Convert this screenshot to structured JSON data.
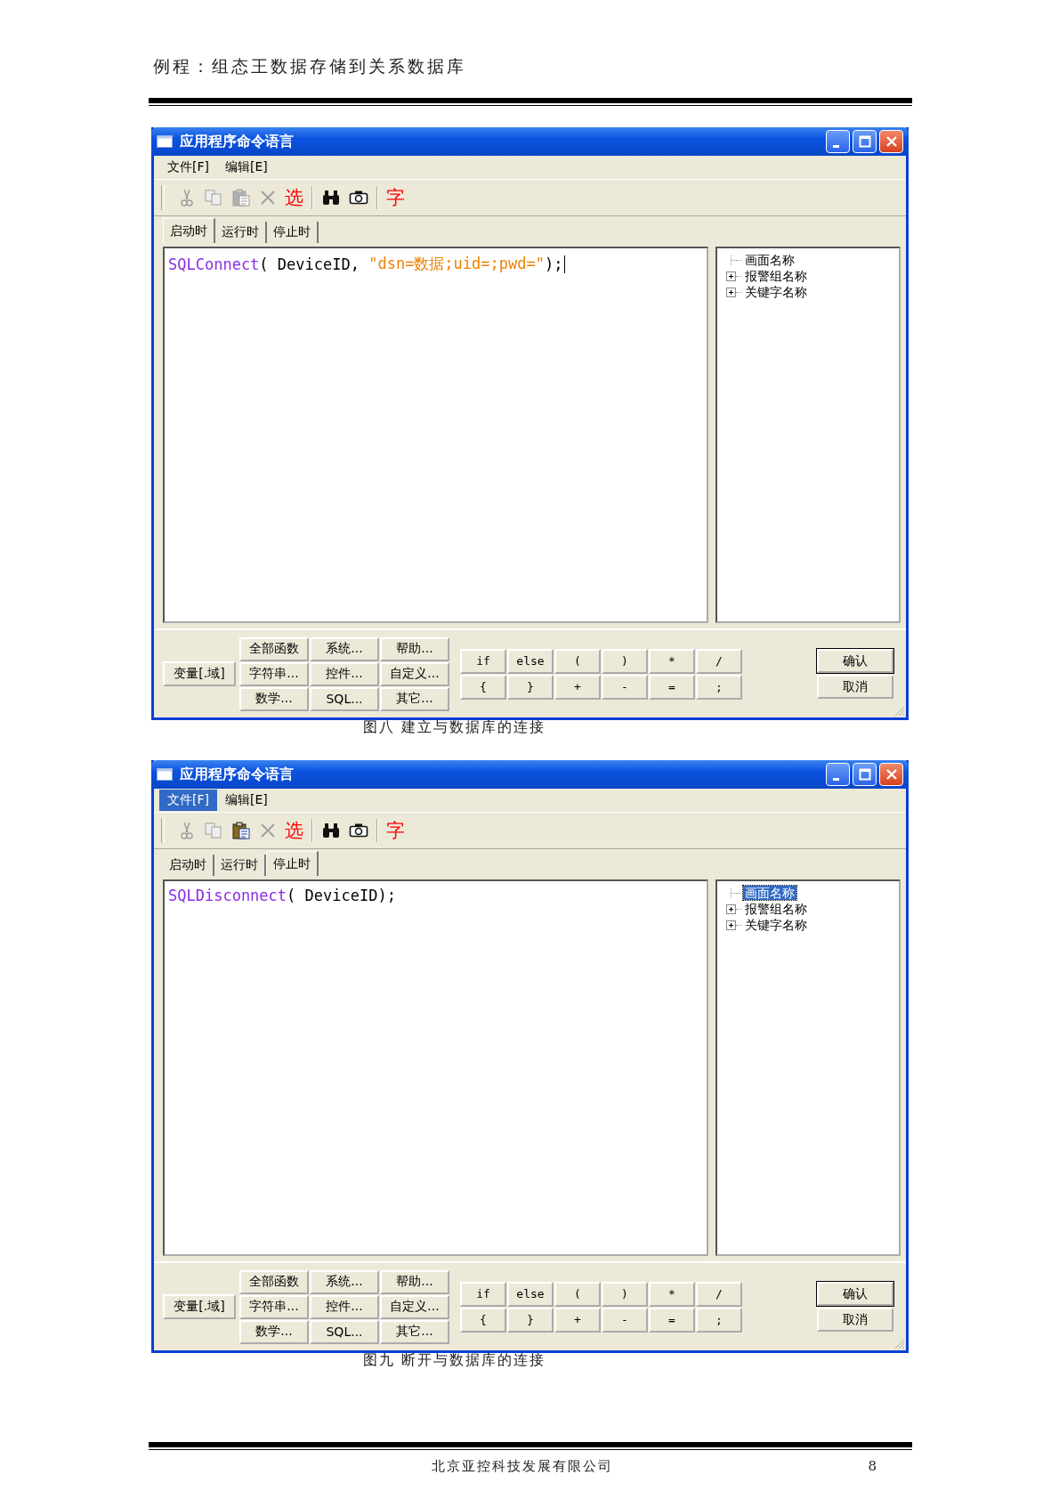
{
  "header": {
    "title": "例程：组态王数据存储到关系数据库"
  },
  "windows": [
    {
      "title": "应用程序命令语言",
      "menu": [
        {
          "label": "文件[F]",
          "selected": false
        },
        {
          "label": "编辑[E]",
          "selected": false
        }
      ],
      "toolbar": [
        {
          "kind": "cut",
          "disabled": true
        },
        {
          "kind": "copy",
          "disabled": true
        },
        {
          "kind": "paste",
          "disabled": true
        },
        {
          "kind": "delete",
          "disabled": true
        },
        {
          "kind": "text",
          "label": "选"
        },
        {
          "kind": "separator"
        },
        {
          "kind": "find"
        },
        {
          "kind": "camera"
        },
        {
          "kind": "separator"
        },
        {
          "kind": "text",
          "label": "字"
        }
      ],
      "tabs": [
        {
          "label": "启动时",
          "selected": true
        },
        {
          "label": "运行时",
          "selected": false
        },
        {
          "label": "停止时",
          "selected": false
        }
      ],
      "code": {
        "tokens": [
          {
            "kind": "function",
            "text": "SQLConnect"
          },
          {
            "kind": "plain",
            "text": "( DeviceID, "
          },
          {
            "kind": "string",
            "text": "\"dsn=数据;uid=;pwd=\""
          },
          {
            "kind": "plain",
            "text": ");"
          }
        ],
        "cursor": true
      },
      "tree": [
        {
          "label": "画面名称",
          "expandable": false,
          "selected": false
        },
        {
          "label": "报警组名称",
          "expandable": true,
          "selected": false
        },
        {
          "label": "关键字名称",
          "expandable": true,
          "selected": false
        }
      ],
      "variable_button": "变量[.域]",
      "function_buttons": [
        "全部函数",
        "系统...",
        "帮助...",
        "字符串...",
        "控件...",
        "自定义...",
        "数学...",
        "SQL...",
        "其它..."
      ],
      "operator_buttons": [
        "if",
        "else",
        "(",
        ")",
        "*",
        "/",
        "{",
        "}",
        "+",
        "-",
        "=",
        ";"
      ],
      "dialog_buttons": [
        "确认",
        "取消"
      ],
      "caption": "图八  建立与数据库的连接"
    },
    {
      "title": "应用程序命令语言",
      "menu": [
        {
          "label": "文件[F]",
          "selected": true
        },
        {
          "label": "编辑[E]",
          "selected": false
        }
      ],
      "toolbar": [
        {
          "kind": "cut",
          "disabled": true
        },
        {
          "kind": "copy",
          "disabled": true
        },
        {
          "kind": "paste",
          "disabled": false
        },
        {
          "kind": "delete",
          "disabled": true
        },
        {
          "kind": "text",
          "label": "选"
        },
        {
          "kind": "separator"
        },
        {
          "kind": "find"
        },
        {
          "kind": "camera"
        },
        {
          "kind": "separator"
        },
        {
          "kind": "text",
          "label": "字"
        }
      ],
      "tabs": [
        {
          "label": "启动时",
          "selected": false
        },
        {
          "label": "运行时",
          "selected": false
        },
        {
          "label": "停止时",
          "selected": true
        }
      ],
      "code": {
        "tokens": [
          {
            "kind": "function",
            "text": "SQLDisconnect"
          },
          {
            "kind": "plain",
            "text": "( DeviceID);"
          }
        ],
        "cursor": false
      },
      "tree": [
        {
          "label": "画面名称",
          "expandable": false,
          "selected": true
        },
        {
          "label": "报警组名称",
          "expandable": true,
          "selected": false
        },
        {
          "label": "关键字名称",
          "expandable": true,
          "selected": false
        }
      ],
      "variable_button": "变量[.域]",
      "function_buttons": [
        "全部函数",
        "系统...",
        "帮助...",
        "字符串...",
        "控件...",
        "自定义...",
        "数学...",
        "SQL...",
        "其它..."
      ],
      "operator_buttons": [
        "if",
        "else",
        "(",
        ")",
        "*",
        "/",
        "{",
        "}",
        "+",
        "-",
        "=",
        ";"
      ],
      "dialog_buttons": [
        "确认",
        "取消"
      ],
      "caption": "图九  断开与数据库的连接"
    }
  ],
  "footer": {
    "company": "北京亚控科技发展有限公司",
    "page_number": "8"
  }
}
